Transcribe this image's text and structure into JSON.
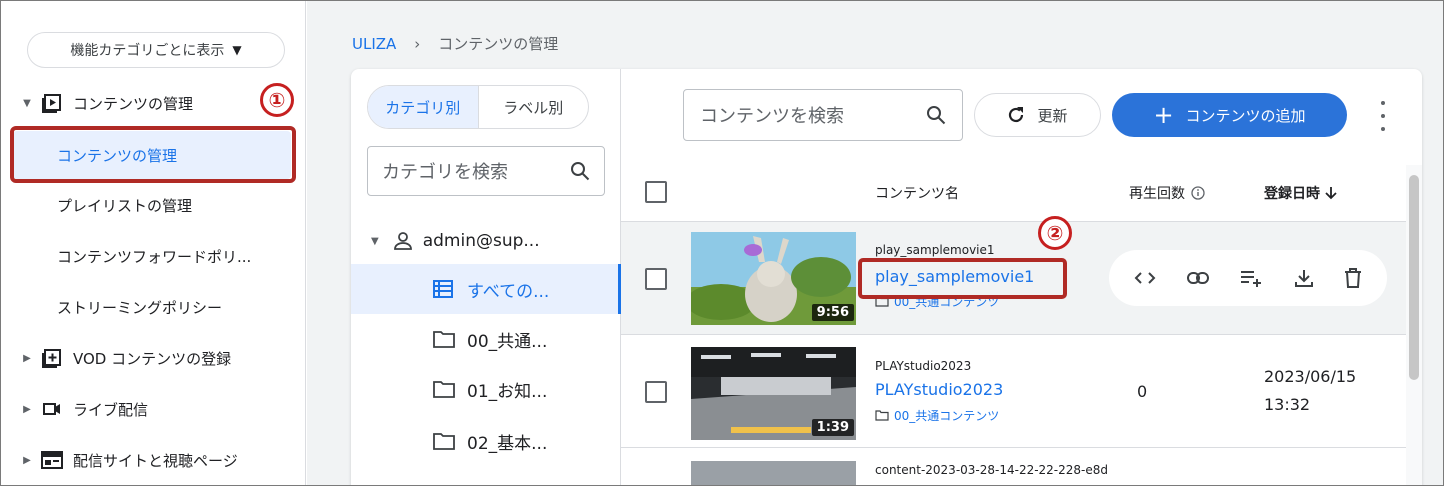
{
  "sidebar": {
    "view_select": "機能カテゴリごとに表示",
    "groups": [
      {
        "label": "コンテンツの管理",
        "expanded": true
      },
      {
        "label": "VOD コンテンツの登録"
      },
      {
        "label": "ライブ配信"
      },
      {
        "label": "配信サイトと視聴ページ"
      }
    ],
    "items": [
      {
        "label": "コンテンツの管理",
        "active": true
      },
      {
        "label": "プレイリストの管理"
      },
      {
        "label": "コンテンツフォワードポリ..."
      },
      {
        "label": "ストリーミングポリシー"
      }
    ]
  },
  "annotations": [
    "①",
    "②"
  ],
  "breadcrumb": {
    "root": "ULIZA",
    "separator": "›",
    "current": "コンテンツの管理"
  },
  "categories": {
    "toggle": [
      "カテゴリ別",
      "ラベル別"
    ],
    "search_placeholder": "カテゴリを検索",
    "tree": [
      {
        "label": "admin@sup...",
        "icon": "person-icon"
      },
      {
        "label": "すべての...",
        "icon": "list-icon",
        "selected": true
      },
      {
        "label": "00_共通...",
        "icon": "folder-icon"
      },
      {
        "label": "01_お知...",
        "icon": "folder-icon"
      },
      {
        "label": "02_基本...",
        "icon": "folder-icon"
      }
    ]
  },
  "toolbar": {
    "search_placeholder": "コンテンツを検索",
    "refresh_label": "更新",
    "add_label": "コンテンツの追加"
  },
  "table": {
    "columns": [
      "コンテンツ名",
      "再生回数",
      "登録日時"
    ],
    "rows": [
      {
        "id": "play_samplemovie1",
        "title": "play_samplemovie1",
        "folder": "00_共通コンテンツ",
        "duration": "9:56",
        "plays": "",
        "date": "",
        "time": ""
      },
      {
        "id": "PLAYstudio2023",
        "title": "PLAYstudio2023",
        "folder": "00_共通コンテンツ",
        "duration": "1:39",
        "plays": "0",
        "date": "2023/06/15",
        "time": "13:32"
      },
      {
        "id": "content-2023-03-28-14-22-22-228-e8d",
        "title": "",
        "folder": "",
        "duration": "",
        "plays": "",
        "date": "",
        "time": ""
      }
    ]
  },
  "colors": {
    "accent": "#1a73e8",
    "add_button": "#2b73d9",
    "annotation": "#b02a25"
  }
}
